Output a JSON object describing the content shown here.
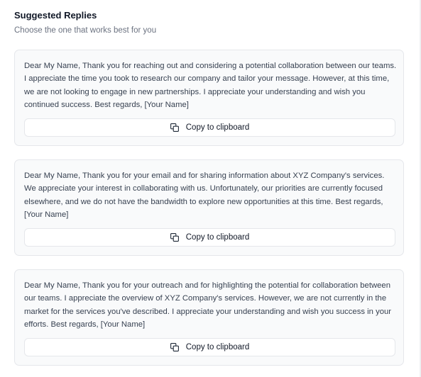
{
  "header": {
    "title": "Suggested Replies",
    "subtitle": "Choose the one that works best for you"
  },
  "replies": [
    {
      "text": "Dear My Name, Thank you for reaching out and considering a potential collaboration between our teams. I appreciate the time you took to research our company and tailor your message. However, at this time, we are not looking to engage in new partnerships. I appreciate your understanding and wish you continued success. Best regards, [Your Name]",
      "copy_label": "Copy to clipboard"
    },
    {
      "text": "Dear My Name, Thank you for your email and for sharing information about XYZ Company's services. We appreciate your interest in collaborating with us. Unfortunately, our priorities are currently focused elsewhere, and we do not have the bandwidth to explore new opportunities at this time. Best regards, [Your Name]",
      "copy_label": "Copy to clipboard"
    },
    {
      "text": "Dear My Name, Thank you for your outreach and for highlighting the potential for collaboration between our teams. I appreciate the overview of XYZ Company's services. However, we are not currently in the market for the services you've described. I appreciate your understanding and wish you success in your efforts. Best regards, [Your Name]",
      "copy_label": "Copy to clipboard"
    }
  ],
  "icons": {
    "copy": "copy-icon"
  }
}
